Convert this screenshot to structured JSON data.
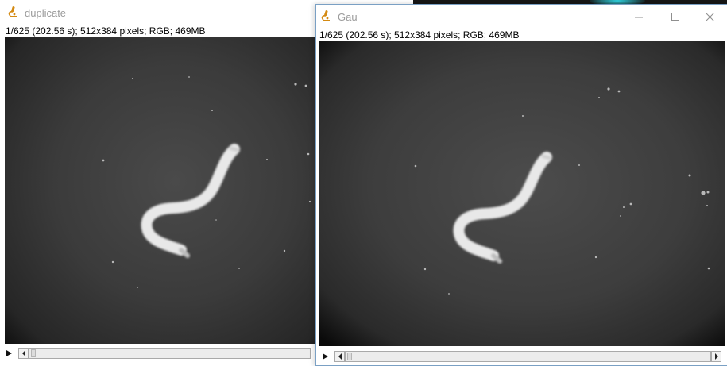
{
  "windows": [
    {
      "title": "duplicate",
      "info": "1/625 (202.56 s); 512x384 pixels; RGB; 469MB",
      "frame": {
        "current": 1,
        "total": 625
      }
    },
    {
      "title": "Gau",
      "info": "1/625 (202.56 s); 512x384 pixels; RGB; 469MB",
      "frame": {
        "current": 1,
        "total": 625
      },
      "controls": [
        "minimize",
        "maximize",
        "close"
      ]
    }
  ],
  "icons": {
    "app": "microscope-icon",
    "play": "play-icon",
    "scroll_left": "chevron-left-icon",
    "scroll_right": "chevron-right-icon",
    "minimize": "minimize-icon",
    "maximize": "maximize-icon",
    "close": "close-icon"
  },
  "colors": {
    "title_text": "#9b9b9b",
    "app_icon": "#d48a12",
    "accent_glow": "#2fd3e0",
    "window_border": "#7aa0c4"
  }
}
